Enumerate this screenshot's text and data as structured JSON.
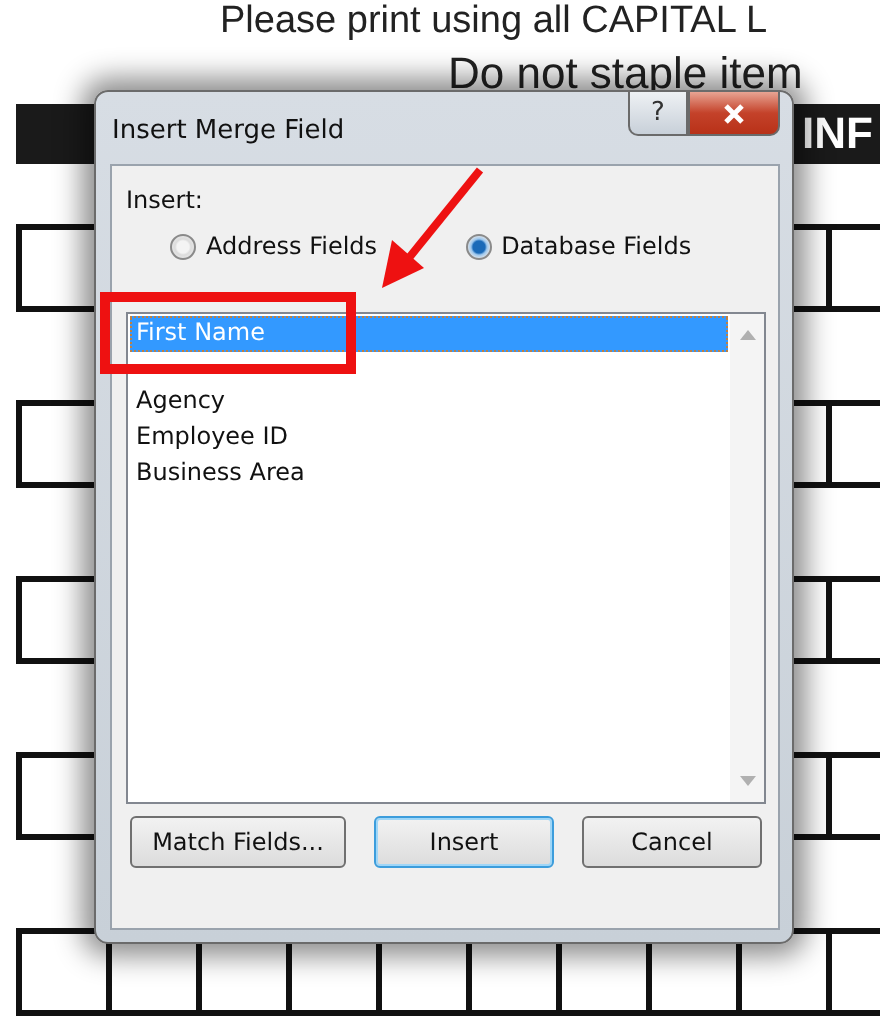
{
  "document": {
    "lines": [
      "Please print using all CAPITAL L",
      "Do not staple item"
    ],
    "header_bar": "INF"
  },
  "dialog": {
    "title": "Insert Merge Field",
    "help_button": "?",
    "insert_label": "Insert:",
    "radios": [
      {
        "label": "Address Fields",
        "selected": false
      },
      {
        "label": "Database Fields",
        "selected": true
      }
    ],
    "fields": [
      {
        "label": "First Name",
        "selected": true
      },
      {
        "label": "Agency",
        "selected": false
      },
      {
        "label": "Employee ID",
        "selected": false
      },
      {
        "label": "Business Area",
        "selected": false
      }
    ],
    "buttons": [
      {
        "label": "Match Fields...",
        "default": false
      },
      {
        "label": "Insert",
        "default": true
      },
      {
        "label": "Cancel",
        "default": false
      }
    ]
  }
}
